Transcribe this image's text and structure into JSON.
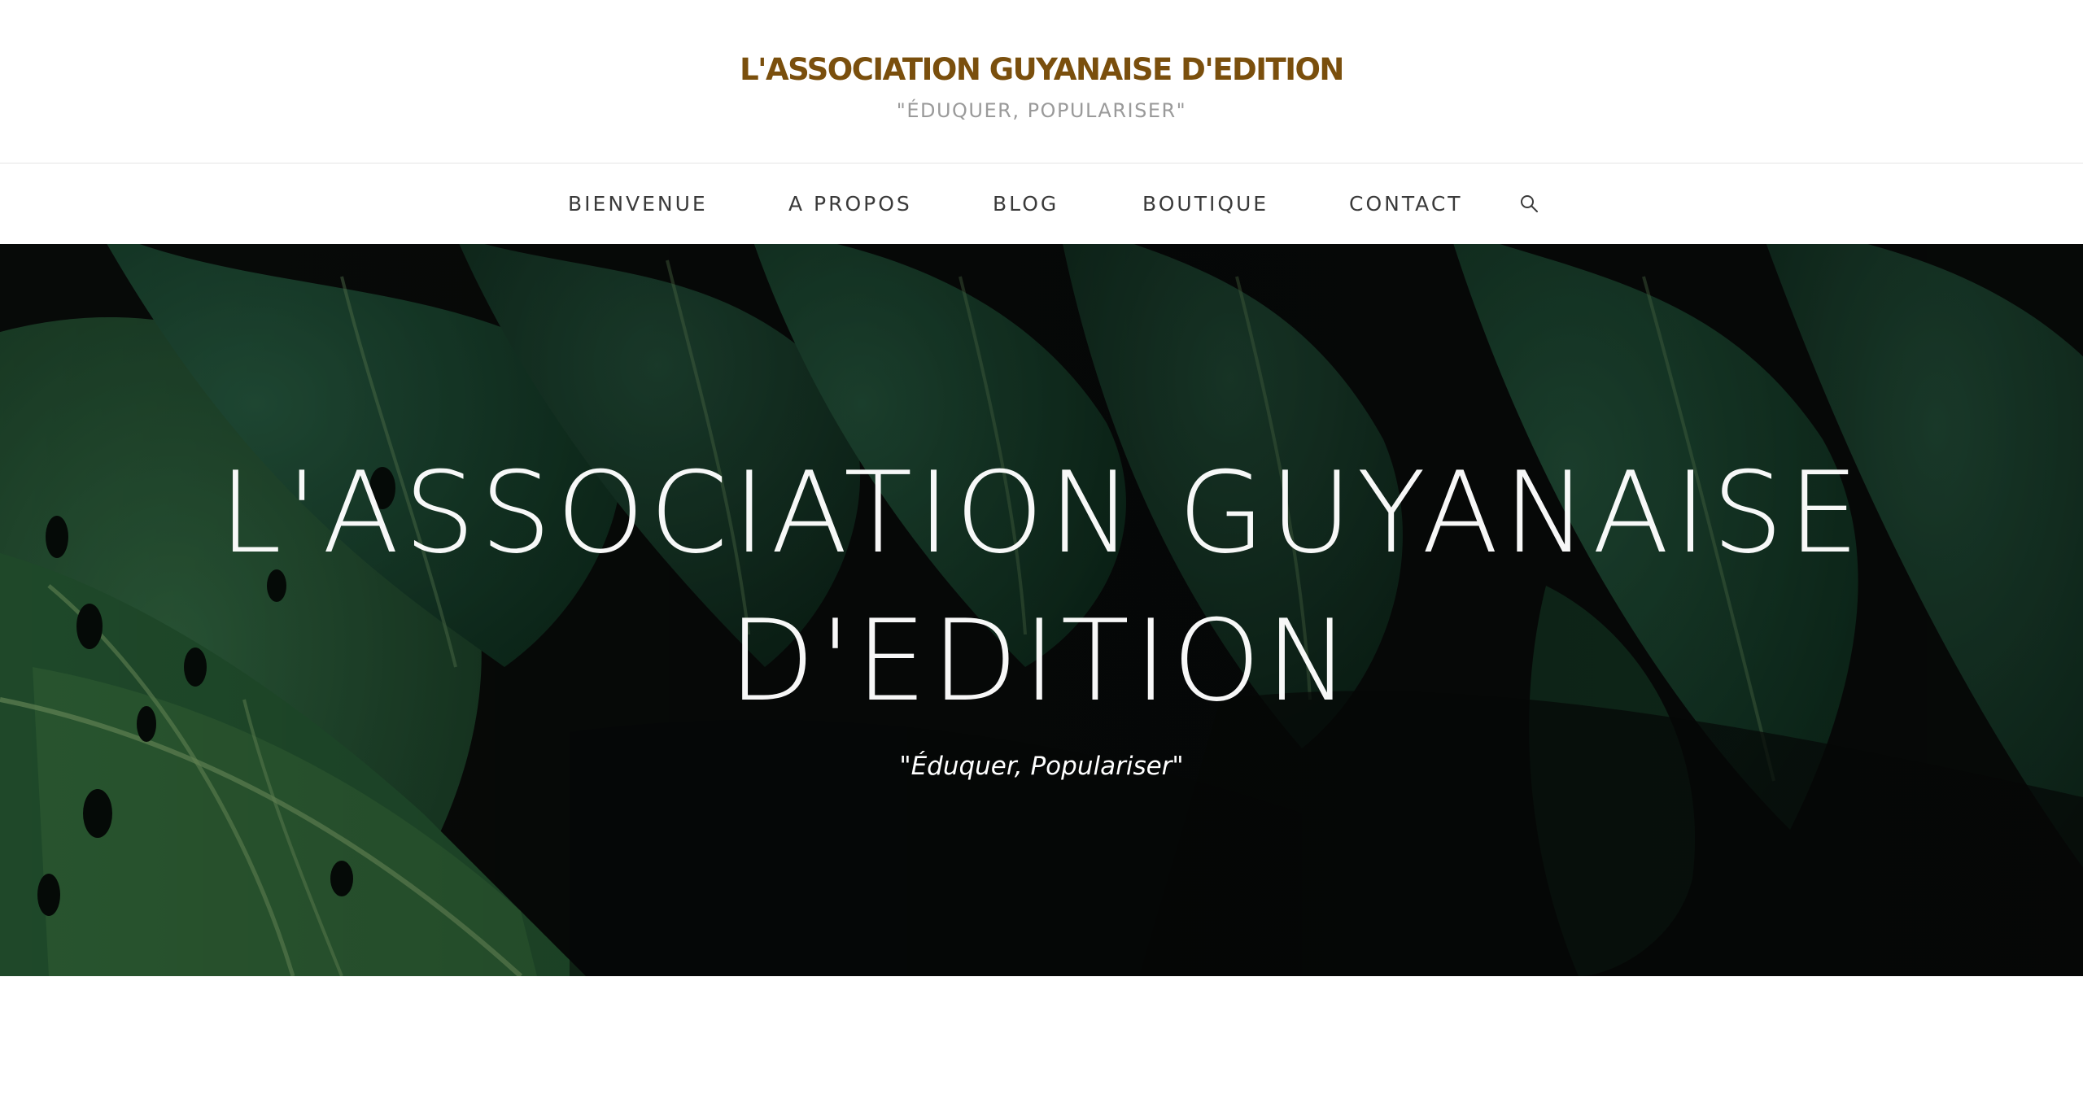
{
  "header": {
    "site_title": "L'ASSOCIATION GUYANAISE D'EDITION",
    "tagline": "\"ÉDUQUER, POPULARISER\"",
    "title_color": "#7a4f0d"
  },
  "nav": {
    "items": [
      {
        "label": "BIENVENUE"
      },
      {
        "label": "A PROPOS"
      },
      {
        "label": "BLOG"
      },
      {
        "label": "BOUTIQUE"
      },
      {
        "label": "CONTACT"
      }
    ],
    "search_icon": "search-icon"
  },
  "hero": {
    "title_line1": "L'ASSOCIATION GUYANAISE",
    "title_line2": "D'EDITION",
    "subtitle": "\"Éduquer, Populariser\"",
    "background": "dark-monstera-leaves"
  }
}
